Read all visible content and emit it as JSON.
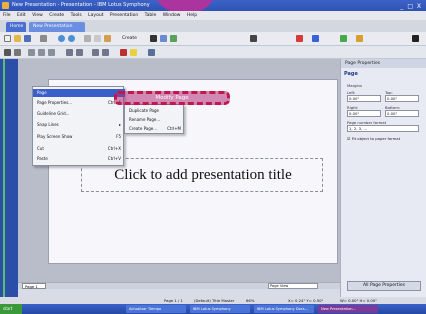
{
  "window": {
    "title": "New Presentation - Presentation - IBM Lotus Symphony",
    "controls": "_ □ X"
  },
  "menubar": [
    "File",
    "Edit",
    "View",
    "Create",
    "Tools",
    "Layout",
    "Presentation",
    "Table",
    "Window",
    "Help"
  ],
  "tabs": {
    "home": "Home",
    "doc": "New Presentation"
  },
  "toolbar": {
    "create_label": "Create"
  },
  "canvas": {
    "placeholder": "Click to add presentation title"
  },
  "context_menu": {
    "items": [
      {
        "label": "Page",
        "shortcut": ""
      },
      {
        "label": "Page Properties...",
        "shortcut": "Ctrl+6"
      },
      {
        "label": "Guideline Grid...",
        "shortcut": ""
      },
      {
        "label": "Snap Lines",
        "shortcut": ""
      },
      {
        "label": "Play Screen Show",
        "shortcut": "F5"
      },
      {
        "label": "Cut",
        "shortcut": "Ctrl+X"
      },
      {
        "label": "Paste",
        "shortcut": "Ctrl+V"
      }
    ],
    "submenu": [
      {
        "label": "Duplicate Page",
        "shortcut": ""
      },
      {
        "label": "Rename Page...",
        "shortcut": ""
      },
      {
        "label": "Create Page...",
        "shortcut": "Ctrl+M"
      }
    ],
    "highlight": "Modify Page"
  },
  "properties_panel": {
    "title": "Page Properties",
    "section": "Page",
    "margins_label": "Margins",
    "left_label": "Left:",
    "top_label": "Top:",
    "right_label": "Right:",
    "bottom_label": "Bottom:",
    "left": "0.00\"",
    "top": "0.00\"",
    "right": "0.00\"",
    "bottom": "0.00\"",
    "number_format_label": "Page number format",
    "number_format": "1, 2, 3, ...",
    "fit_label": "Fit object to paper format",
    "button": "All Page Properties"
  },
  "page_tab": "Page 1",
  "view_select": "Page View",
  "status": {
    "page": "Page 1 / 1",
    "master": "(Default) Title Master",
    "zoom": "66%",
    "pos": "X= 0.24\" Y= 0.50\"",
    "size": "W= 0.00\" H= 0.00\""
  },
  "taskbar": {
    "start": "start",
    "items": [
      "Actualizar Tiempo",
      "IBM Lotus Symphony",
      "IBM Lotus Symphony Docs...",
      "New Presentation..."
    ]
  }
}
